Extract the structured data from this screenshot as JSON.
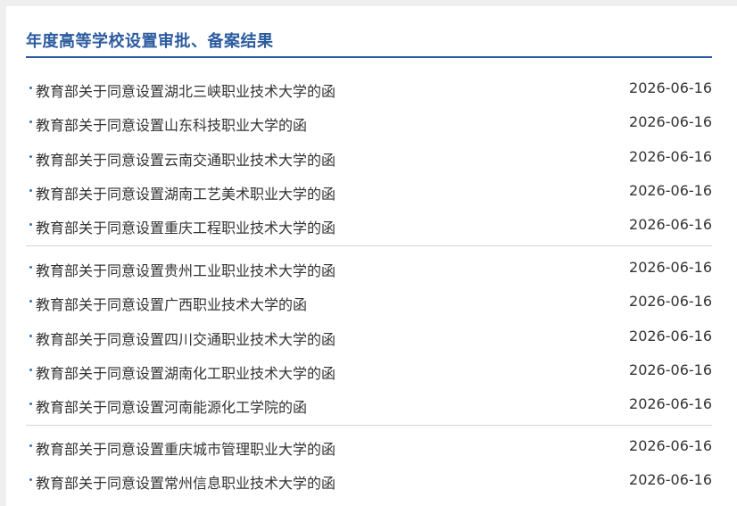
{
  "section": {
    "title": "年度高等学校设置审批、备案结果"
  },
  "groups": [
    {
      "items": [
        {
          "title": "教育部关于同意设置湖北三峡职业技术大学的函",
          "date": "2026-06-16"
        },
        {
          "title": "教育部关于同意设置山东科技职业大学的函",
          "date": "2026-06-16"
        },
        {
          "title": "教育部关于同意设置云南交通职业技术大学的函",
          "date": "2026-06-16"
        },
        {
          "title": "教育部关于同意设置湖南工艺美术职业大学的函",
          "date": "2026-06-16"
        },
        {
          "title": "教育部关于同意设置重庆工程职业技术大学的函",
          "date": "2026-06-16"
        }
      ]
    },
    {
      "items": [
        {
          "title": "教育部关于同意设置贵州工业职业技术大学的函",
          "date": "2026-06-16"
        },
        {
          "title": "教育部关于同意设置广西职业技术大学的函",
          "date": "2026-06-16"
        },
        {
          "title": "教育部关于同意设置四川交通职业技术大学的函",
          "date": "2026-06-16"
        },
        {
          "title": "教育部关于同意设置湖南化工职业技术大学的函",
          "date": "2026-06-16"
        },
        {
          "title": "教育部关于同意设置河南能源化工学院的函",
          "date": "2026-06-16"
        }
      ]
    },
    {
      "items": [
        {
          "title": "教育部关于同意设置重庆城市管理职业大学的函",
          "date": "2026-06-16"
        },
        {
          "title": "教育部关于同意设置常州信息职业技术大学的函",
          "date": "2026-06-16"
        }
      ]
    }
  ]
}
